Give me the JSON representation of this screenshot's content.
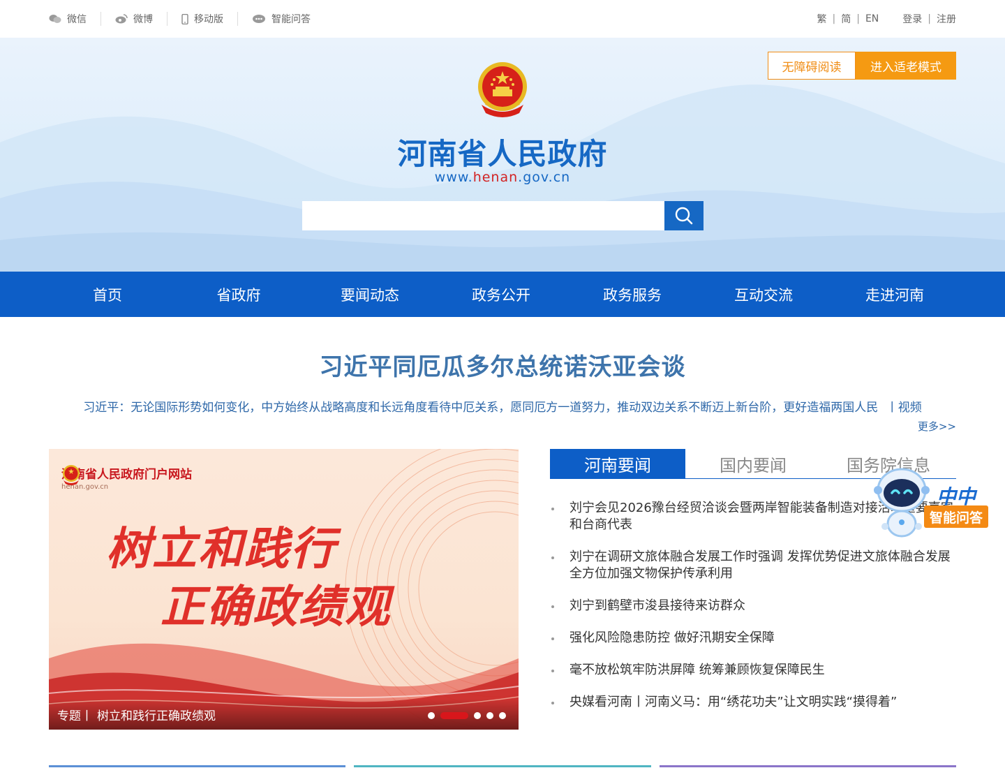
{
  "topbar": {
    "links": [
      {
        "label": "微信",
        "icon": "wechat-icon"
      },
      {
        "label": "微博",
        "icon": "weibo-icon"
      },
      {
        "label": "移动版",
        "icon": "mobile-icon"
      },
      {
        "label": "智能问答",
        "icon": "chat-icon"
      }
    ],
    "lang": [
      "繁",
      "简",
      "EN"
    ],
    "auth": [
      "登录",
      "注册"
    ],
    "sep": "|"
  },
  "header": {
    "title": "河南省人民政府",
    "url_prefix": "www.",
    "url_highlight": "henan",
    "url_suffix": ".gov.cn",
    "accessibility_label": "无障碍阅读",
    "elder_mode_label": "进入适老模式",
    "search_placeholder": ""
  },
  "nav": [
    "首页",
    "省政府",
    "要闻动态",
    "政务公开",
    "政务服务",
    "互动交流",
    "走进河南"
  ],
  "headline": {
    "title": "习近平同厄瓜多尔总统诺沃亚会谈",
    "subtitle": "习近平：无论国际形势如何变化，中方始终从战略高度和长远角度看待中厄关系，愿同厄方一道努力，推动双边关系不断迈上新台阶，更好造福两国人民",
    "video_label": "丨视频",
    "more": "更多>>"
  },
  "banner": {
    "logo_title": "河南省人民政府门户网站",
    "logo_url": "henan.gov.cn",
    "line1": "树立和践行",
    "line2": "正确政绩观",
    "caption_tag": "专题丨",
    "caption": "树立和践行正确政绩观",
    "slides_total": 5,
    "slide_active": 2
  },
  "news": {
    "tabs": [
      "河南要闻",
      "国内要闻",
      "国务院信息"
    ],
    "active_tab": 0,
    "items": [
      "刘宁会见2026豫台经贸洽谈会暨两岸智能装备制造对接活动重要嘉宾和台商代表",
      "刘宁在调研文旅体融合发展工作时强调 发挥优势促进文旅体融合发展 全方位加强文物保护传承利用",
      "刘宁到鹤壁市浚县接待来访群众",
      "强化风险隐患防控 做好汛期安全保障",
      "毫不放松筑牢防洪屏障 统筹兼顾恢复保障民生",
      "央媒看河南丨河南义马：用“绣花功夫”让文明实践“摸得着”"
    ]
  },
  "robot": {
    "name": "中中",
    "button": "智能问答"
  },
  "colors": {
    "primary": "#0d5ec7",
    "accent_orange": "#f59a12",
    "headline_blue": "#3e74ab",
    "banner_red": "#e0302a",
    "bottom_lines": [
      "#5b8fd6",
      "#4fb5c2",
      "#8a74c9"
    ]
  }
}
